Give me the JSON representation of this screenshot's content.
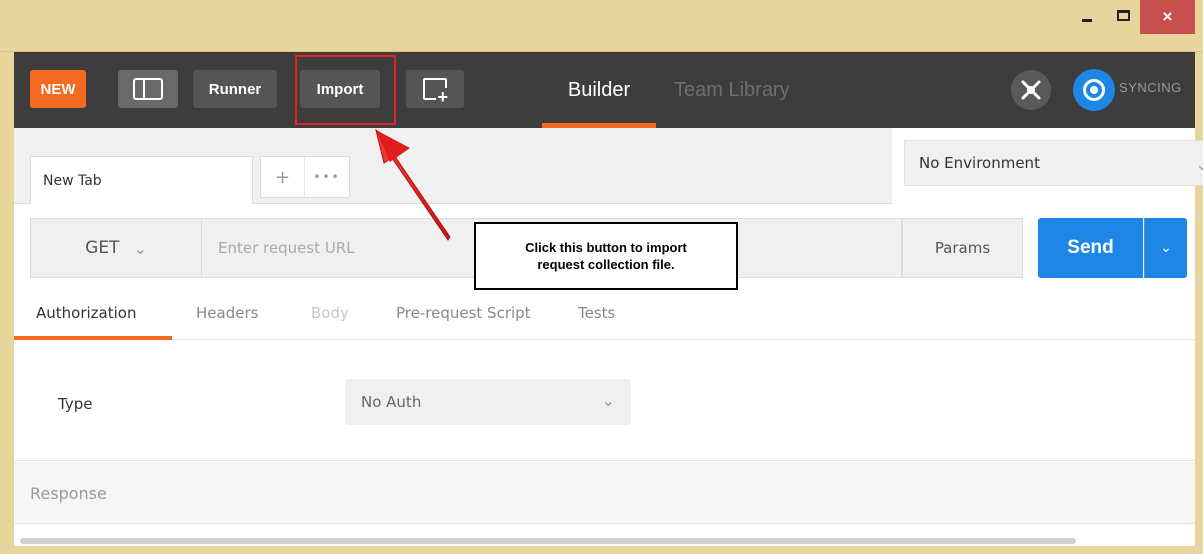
{
  "window": {
    "minimize_label": "–",
    "maximize_label": "□",
    "close_label": "×"
  },
  "header": {
    "new_label": "NEW",
    "runner_label": "Runner",
    "import_label": "Import",
    "tabs": [
      {
        "label": "Builder",
        "active": true
      },
      {
        "label": "Team Library",
        "active": false
      }
    ],
    "sync_label": "SYNCING",
    "accent_color": "#f26b21",
    "brand_blue": "#1e87e6"
  },
  "tabstrip": {
    "tab_label": "New Tab",
    "add_glyph": "+",
    "more_glyph": "•••"
  },
  "environment": {
    "selected": "No Environment"
  },
  "request": {
    "method": "GET",
    "url_placeholder": "Enter request URL",
    "params_label": "Params",
    "send_label": "Send"
  },
  "callout": {
    "line1": "Click this button to import",
    "line2": "request collection file."
  },
  "subtabs": [
    {
      "label": "Authorization",
      "state": "active"
    },
    {
      "label": "Headers",
      "state": "normal"
    },
    {
      "label": "Body",
      "state": "disabled"
    },
    {
      "label": "Pre-request Script",
      "state": "normal"
    },
    {
      "label": "Tests",
      "state": "normal"
    }
  ],
  "auth": {
    "type_label": "Type",
    "selected": "No Auth"
  },
  "response": {
    "label": "Response"
  }
}
